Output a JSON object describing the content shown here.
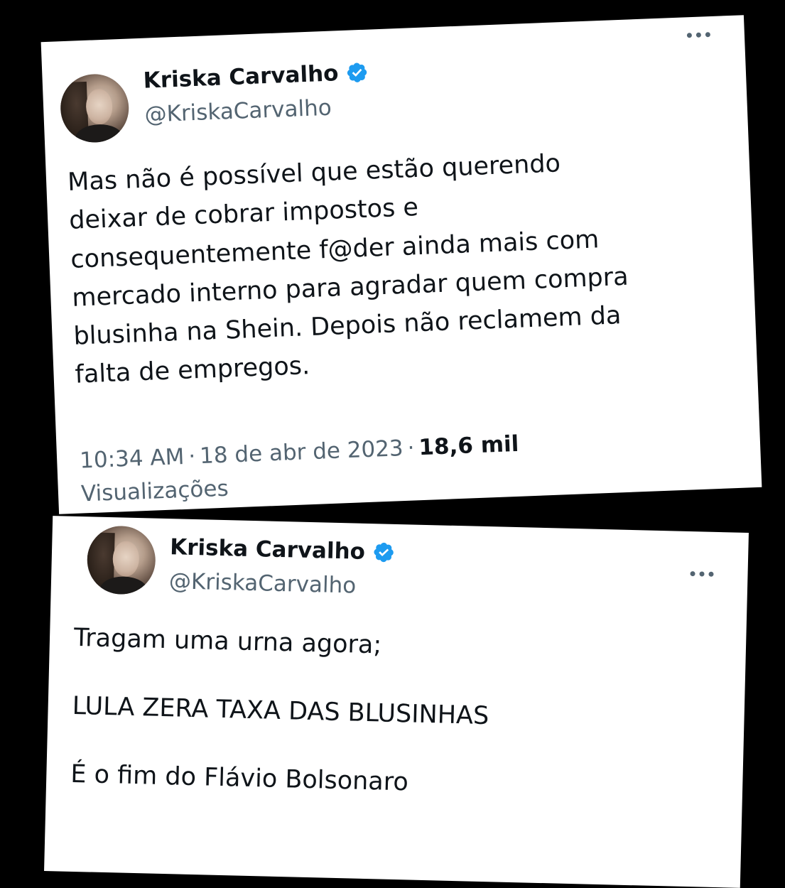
{
  "colors": {
    "background": "#000000",
    "card": "#ffffff",
    "text_primary": "#0f1419",
    "text_secondary": "#536471",
    "verified_badge": "#1d9bf0"
  },
  "tweets": [
    {
      "author": {
        "name": "Kriska Carvalho",
        "handle": "@KriskaCarvalho",
        "verified_icon": "verified-badge-icon"
      },
      "more_icon": "more-options-icon",
      "text_lines": [
        "Mas não é possível que estão querendo",
        "deixar de cobrar impostos e",
        "consequentemente f@der ainda mais com",
        "mercado interno para agradar quem compra",
        "blusinha na Shein. Depois não reclamem da",
        "falta de empregos."
      ],
      "time": "10:34 AM",
      "date": "18 de abr de 2023",
      "separator": "·",
      "views_count": "18,6 mil",
      "views_label": "Visualizações"
    },
    {
      "author": {
        "name": "Kriska Carvalho",
        "handle": "@KriskaCarvalho",
        "verified_icon": "verified-badge-icon"
      },
      "more_icon": "more-options-icon",
      "paragraphs": [
        "Tragam uma urna agora;",
        "LULA ZERA TAXA DAS BLUSINHAS",
        "É o fim do Flávio Bolsonaro"
      ]
    }
  ]
}
